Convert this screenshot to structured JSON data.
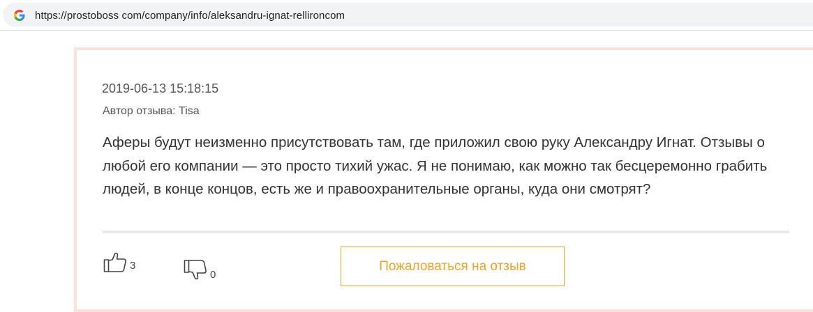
{
  "browser": {
    "url": "https://prostoboss com/company/info/aleksandru-ignat-rellironcom",
    "favicon_icon": "google-g-icon"
  },
  "review": {
    "date": "2019-06-13 15:18:15",
    "author_label": "Автор отзыва: Tisa",
    "text": "Аферы будут неизменно присутствовать там, где приложил свою руку Александру Игнат. Отзывы о любой его компании — это просто тихий ужас. Я не понимаю, как можно так бесцеремонно грабить людей, в конце концов, есть же и правоохранительные органы, куда они смотрят?",
    "likes": "3",
    "dislikes": "0",
    "like_icon": "thumbs-up-icon",
    "dislike_icon": "thumbs-down-icon",
    "complain_label": "Пожаловаться на отзыв"
  },
  "colors": {
    "accent": "#e8a42c",
    "card_border": "#fde1de",
    "text": "#333333"
  }
}
